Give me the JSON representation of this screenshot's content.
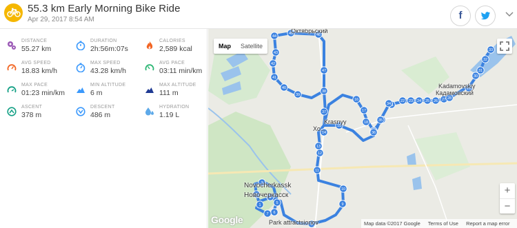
{
  "activity": {
    "title": "55.3 km Early Morning Bike Ride",
    "date": "Apr 29, 2017 8:54 AM",
    "icon": "bicycle-icon",
    "icon_color": "#f5b700"
  },
  "share": {
    "facebook_glyph": "f",
    "facebook_color": "#3b5998",
    "twitter_color": "#1da1f2",
    "more_icon": "chevron-down-icon"
  },
  "stats": [
    {
      "id": "distance",
      "label": "DISTANCE",
      "value": "55.27 km",
      "icon": "waypoints-icon",
      "color": "#9b59b6"
    },
    {
      "id": "duration",
      "label": "DURATION",
      "value": "2h:56m:07s",
      "icon": "stopwatch-icon",
      "color": "#3b99fc"
    },
    {
      "id": "calories",
      "label": "CALORIES",
      "value": "2,589 kcal",
      "icon": "flame-icon",
      "color": "#f26522"
    },
    {
      "id": "avg-speed",
      "label": "AVG SPEED",
      "value": "18.83 km/h",
      "icon": "speedometer-icon",
      "color": "#f26522"
    },
    {
      "id": "max-speed",
      "label": "MAX SPEED",
      "value": "43.28 km/h",
      "icon": "stopwatch-icon",
      "color": "#3b99fc"
    },
    {
      "id": "avg-pace",
      "label": "AVG PACE",
      "value": "03:11 min/km",
      "icon": "speedometer-icon",
      "color": "#2bb673"
    },
    {
      "id": "max-pace",
      "label": "MAX PACE",
      "value": "01:23 min/km",
      "icon": "speedometer-icon",
      "color": "#14a085"
    },
    {
      "id": "min-altitude",
      "label": "MIN ALTITUDE",
      "value": "6 m",
      "icon": "mountain-icon",
      "color": "#3b99fc"
    },
    {
      "id": "max-altitude",
      "label": "MAX ALTITUDE",
      "value": "111 m",
      "icon": "mountain-icon",
      "color": "#1f3a93"
    },
    {
      "id": "ascent",
      "label": "ASCENT",
      "value": "378 m",
      "icon": "ascent-icon",
      "color": "#14a085"
    },
    {
      "id": "descent",
      "label": "DESCENT",
      "value": "486 m",
      "icon": "descent-icon",
      "color": "#3b99fc"
    },
    {
      "id": "hydration",
      "label": "HYDRATION",
      "value": "1.19 L",
      "icon": "water-drops-icon",
      "color": "#5da9e9"
    }
  ],
  "map": {
    "type_options": [
      "Map",
      "Satellite"
    ],
    "type_selected": "Map",
    "zoom_in": "+",
    "zoom_out": "−",
    "google_logo": "Google",
    "attribution": [
      "Map data ©2017 Google",
      "Terms of Use",
      "Report a map error"
    ],
    "place_labels": [
      "Октябрьский",
      "Kadamovskiy",
      "Кадамовский",
      "Krasnyy",
      "Кр...",
      "Хо...",
      "Novocherkassk",
      "Новочеркасск",
      "Park attractsionov"
    ],
    "route_color": "#3b82e0",
    "markers": [
      "1",
      "2",
      "3",
      "4",
      "5",
      "6",
      "7",
      "8",
      "9",
      "10",
      "11",
      "12",
      "13",
      "14",
      "15",
      "16",
      "17",
      "18",
      "19",
      "20",
      "21",
      "22",
      "23",
      "24",
      "25",
      "26",
      "27",
      "28",
      "29",
      "30",
      "31",
      "32",
      "33",
      "34",
      "35",
      "36",
      "37",
      "38",
      "39",
      "40",
      "41",
      "42",
      "43",
      "44",
      "45",
      "46",
      "47"
    ]
  }
}
